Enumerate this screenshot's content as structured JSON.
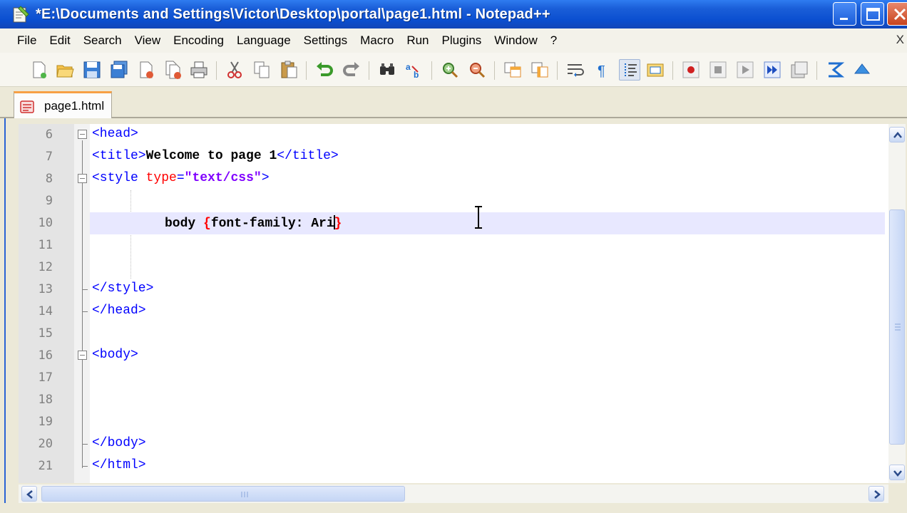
{
  "window": {
    "title": "*E:\\Documents and Settings\\Victor\\Desktop\\portal\\page1.html - Notepad++"
  },
  "menu": [
    "File",
    "Edit",
    "Search",
    "View",
    "Encoding",
    "Language",
    "Settings",
    "Macro",
    "Run",
    "Plugins",
    "Window",
    "?"
  ],
  "menu_close": "X",
  "toolbar": {
    "buttons": [
      "new-file-icon",
      "open-file-icon",
      "save-icon",
      "save-all-icon",
      "close-icon",
      "close-all-icon",
      "print-icon",
      "cut-icon",
      "copy-icon",
      "paste-icon",
      "undo-icon",
      "redo-icon",
      "find-icon",
      "replace-icon",
      "zoom-in-icon",
      "zoom-out-icon",
      "sync-vertical-icon",
      "sync-horizontal-icon",
      "word-wrap-icon",
      "show-all-chars-icon",
      "indent-guide-icon",
      "user-lang-icon",
      "record-macro-icon",
      "stop-record-icon",
      "play-macro-icon",
      "run-macro-multiple-icon",
      "save-macro-icon",
      "function-list-icon",
      "upload-icon"
    ]
  },
  "tabs": [
    {
      "label": "page1.html",
      "active": true
    }
  ],
  "editor": {
    "lines": [
      {
        "num": "6",
        "text": "<head>"
      },
      {
        "num": "7",
        "text": "<title>Welcome to page 1</title>"
      },
      {
        "num": "8",
        "text": "<style type=\"text/css\">"
      },
      {
        "num": "9",
        "text": ""
      },
      {
        "num": "10",
        "text": "body {font-family: Ari}"
      },
      {
        "num": "11",
        "text": ""
      },
      {
        "num": "12",
        "text": ""
      },
      {
        "num": "13",
        "text": "</style>"
      },
      {
        "num": "14",
        "text": "</head>"
      },
      {
        "num": "15",
        "text": ""
      },
      {
        "num": "16",
        "text": "<body>"
      },
      {
        "num": "17",
        "text": ""
      },
      {
        "num": "18",
        "text": ""
      },
      {
        "num": "19",
        "text": ""
      },
      {
        "num": "20",
        "text": "</body>"
      },
      {
        "num": "21",
        "text": "</html>"
      }
    ],
    "current_line": "10"
  }
}
